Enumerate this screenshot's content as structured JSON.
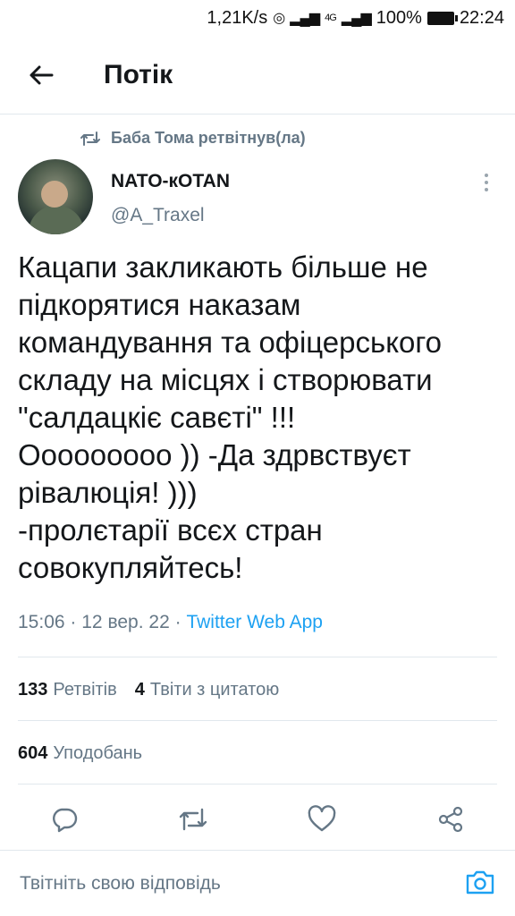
{
  "status_bar": {
    "speed": "1,21K/s",
    "network": "4G",
    "battery": "100%",
    "time": "22:24"
  },
  "header": {
    "title": "Потік"
  },
  "retweet": {
    "text": "Баба Тома ретвітнув(ла)"
  },
  "tweet": {
    "display_name": "NATO-кOTAN",
    "handle": "@A_Traxel",
    "text": "Кацапи закликають більше не підкорятися наказам командування та офіцерського складу на місцях і створювати \"салдацкіє савєті\" !!!\nОооооoooo )) -Да здрвствуєт рівалюція! )))\n-пролєтарії всєх стран совокупляйтесь!",
    "time": "15:06",
    "date": "12 вер. 22",
    "separator": "·",
    "source": "Twitter Web App"
  },
  "stats": {
    "retweets_count": "133",
    "retweets_label": "Ретвітів",
    "quotes_count": "4",
    "quotes_label": "Твіти з цитатою",
    "likes_count": "604",
    "likes_label": "Уподобань"
  },
  "actions": [
    "reply-icon",
    "retweet-icon",
    "like-icon",
    "share-icon"
  ],
  "reply_bar": {
    "placeholder": "Твітніть свою відповідь"
  },
  "colors": {
    "accent": "#1da1f2",
    "muted": "#657786",
    "text": "#14171a"
  }
}
